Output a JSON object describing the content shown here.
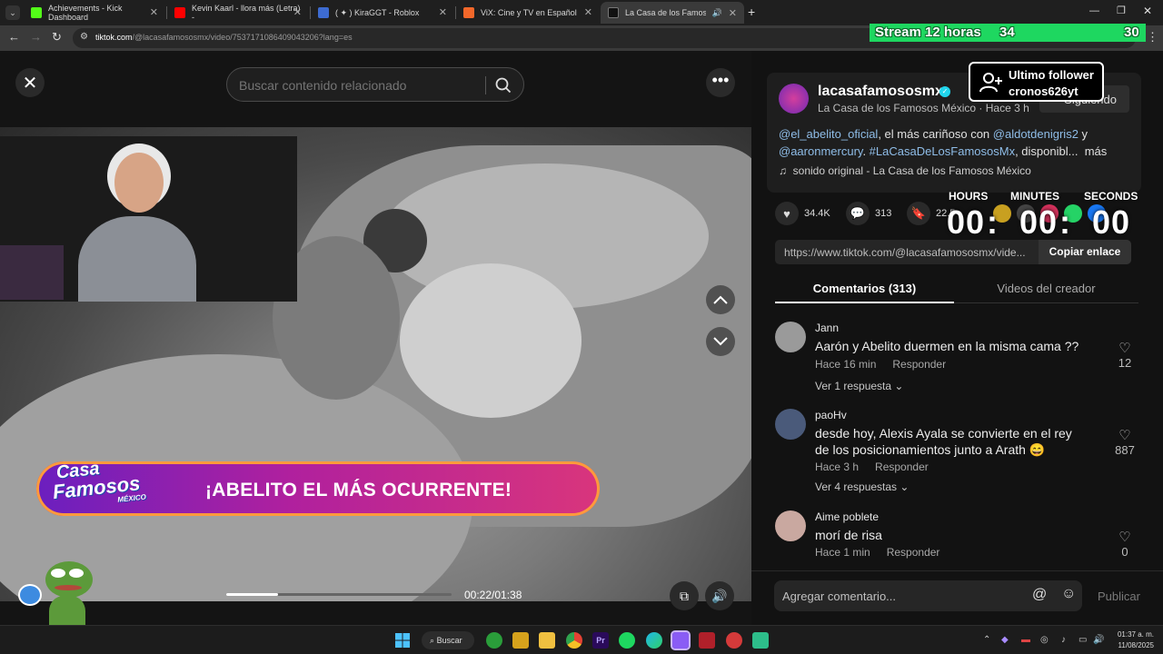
{
  "browser": {
    "tabs": [
      {
        "title": "Achievements - Kick Dashboard",
        "color": "#53fc18"
      },
      {
        "title": "Kevin Kaarl - llora más (Letra) -",
        "color": "#ff0000"
      },
      {
        "title": "( ✦ ) KiraGGT - Roblox",
        "color": "#3d6bd1"
      },
      {
        "title": "ViX: Cine y TV en Español",
        "color": "#f2672a"
      },
      {
        "title": "La Casa de los Famosos",
        "color": "#111111"
      }
    ],
    "url_host": "tiktok.com",
    "url_path": "/@lacasafamososmx/video/7537171086409043206?lang=es"
  },
  "viewer": {
    "search_placeholder": "Buscar contenido relacionado",
    "banner_text": "¡ABELITO EL MÁS OCURRENTE!",
    "banner_logo": [
      "La",
      "Casa",
      "de los",
      "Famosos",
      "MÉXICO"
    ],
    "time": "00:22/01:38",
    "progress": 0.23
  },
  "post": {
    "username": "lacasafamososmx",
    "subline": "La Casa de los Famosos México · Hace 3 h",
    "follow_label": "Siguiendo",
    "desc_mention1": "@el_abelito_oficial",
    "desc_part1": ", el más cariñoso con ",
    "desc_mention2": "@aldotdenigris2",
    "desc_part2": " y",
    "desc_mention3": "@aaronmercury",
    "desc_part3": ". ",
    "desc_hashtag": "#LaCasaDeLosFamososMx",
    "desc_part4": ", disponibl...",
    "desc_more": "más",
    "sound": "sonido original - La Casa de los Famosos México",
    "likes": "34.4K",
    "comments": "313",
    "saves": "22.5",
    "link": "https://www.tiktok.com/@lacasafamososmx/vide...",
    "copy_label": "Copiar enlace",
    "tab_comments": "Comentarios (313)",
    "tab_creator": "Videos del creador"
  },
  "comments": [
    {
      "user": "Jann",
      "text": "Aarón y Abelito duermen en la misma cama ??",
      "time": "Hace 16 min",
      "reply": "Responder",
      "likes": "12",
      "replies": "Ver 1 respuesta"
    },
    {
      "user": "paoHv",
      "text": "desde hoy, Alexis Ayala se convierte en el rey de los posicionamientos junto a Arath 😄",
      "time": "Hace 3 h",
      "reply": "Responder",
      "likes": "887",
      "replies": "Ver 4 respuestas"
    },
    {
      "user": "Aime poblete",
      "text": "morí de risa",
      "time": "Hace 1 min",
      "reply": "Responder",
      "likes": "0"
    }
  ],
  "add_comment": {
    "placeholder": "Agregar comentario...",
    "publish": "Publicar"
  },
  "overlays": {
    "stream_label": "Stream 12 horas",
    "stream_num1": "34",
    "stream_num2": "30",
    "follower_title": "Ultimo follower",
    "follower_name": "cronos626yt",
    "timer_hours": "HOURS",
    "timer_minutes": "MINUTES",
    "timer_seconds": "SECONDS",
    "timer_h": "00",
    "timer_m": "00",
    "timer_s": "00"
  },
  "taskbar": {
    "search_label": "Buscar",
    "time": "01:37 a. m.",
    "date": "11/08/2025"
  }
}
